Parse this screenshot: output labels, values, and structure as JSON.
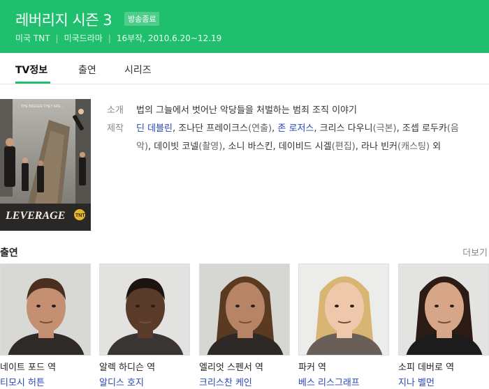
{
  "header": {
    "title": "레버리지 시즌 3",
    "badge": "방송종료",
    "meta": [
      "미국 TNT",
      "미국드라마",
      "16부작, 2010.6.20~12.19"
    ]
  },
  "tabs": [
    {
      "label": "TV정보",
      "active": true
    },
    {
      "label": "출연",
      "active": false
    },
    {
      "label": "시리즈",
      "active": false
    }
  ],
  "poster": {
    "tagline": "THE BIGGER THEY ARE...",
    "logo": "LEVERAGE",
    "network": "TNT"
  },
  "info": {
    "intro_label": "소개",
    "intro_text": "법의 그늘에서 벗어난 악당들을 처벌하는 범죄 조직 이야기",
    "credits_label": "제작",
    "credits": [
      {
        "text": "딘 데블린",
        "link": true
      },
      {
        "text": ", 조나단 프레이크스",
        "link": false
      },
      {
        "text": "(연출)",
        "note": true
      },
      {
        "text": ", ",
        "link": false
      },
      {
        "text": "존 로저스",
        "link": true
      },
      {
        "text": ", 크리스 다우니",
        "link": false
      },
      {
        "text": "(극본)",
        "note": true
      },
      {
        "text": ", 조셉 로두카",
        "link": false
      },
      {
        "text": "(음악)",
        "note": true
      },
      {
        "text": ", 데이빗 코넬",
        "link": false
      },
      {
        "text": "(촬영)",
        "note": true
      },
      {
        "text": ", 소니 바스킨, 데이비드 시겔",
        "link": false
      },
      {
        "text": "(편집)",
        "note": true
      },
      {
        "text": ", 라나 빈커",
        "link": false
      },
      {
        "text": "(캐스팅)",
        "note": true
      },
      {
        "text": " 외",
        "link": false
      }
    ]
  },
  "cast_section": {
    "title": "출연",
    "more": "더보기"
  },
  "cast": [
    {
      "role": "네이트 포드 역",
      "actor": "티모시 허튼",
      "skin": "#c58f72",
      "hair": "#4a2f20",
      "bg": "#d8d8d5",
      "shirt": "#2f2a28"
    },
    {
      "role": "알렉 하디슨 역",
      "actor": "알디스 호지",
      "skin": "#5a3a28",
      "hair": "#1c1410",
      "bg": "#e2e2e0",
      "shirt": "#3a3533"
    },
    {
      "role": "엘리엇 스펜서 역",
      "actor": "크리스찬 케인",
      "skin": "#b88466",
      "hair": "#5a3b22",
      "bg": "#d6d6d2",
      "shirt": "#2e2826"
    },
    {
      "role": "파커 역",
      "actor": "베스 리스그래프",
      "skin": "#efc7aa",
      "hair": "#d9b574",
      "bg": "#ececea",
      "shirt": "#6a5e58"
    },
    {
      "role": "소피 데버로 역",
      "actor": "지나 벨먼",
      "skin": "#d7a587",
      "hair": "#2c1c15",
      "bg": "#e3e3e1",
      "shirt": "#1c1c1c"
    }
  ]
}
